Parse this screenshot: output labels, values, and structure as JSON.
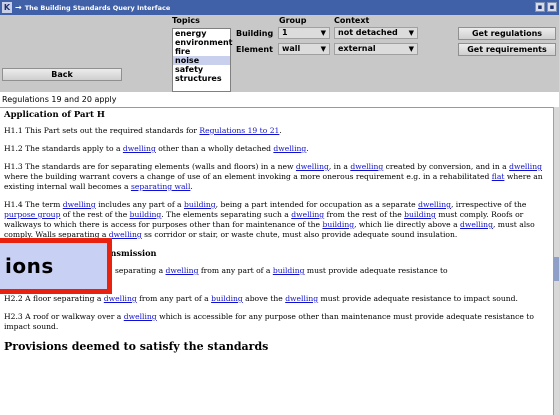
{
  "window": {
    "title": "The Building Standards Query Interface"
  },
  "headers": {
    "topics": "Topics",
    "group": "Group",
    "context": "Context"
  },
  "topics": [
    "energy",
    "environment",
    "fire",
    "noise",
    "safety",
    "structures"
  ],
  "topics_selected": "noise",
  "building": {
    "label": "Building",
    "value": "1"
  },
  "element": {
    "label": "Element",
    "value": "wall"
  },
  "context_building": "not detached",
  "context_element": "external",
  "buttons": {
    "back": "Back",
    "get_regulations": "Get regulations",
    "get_requirements": "Get requirements"
  },
  "status": "Regulations 19 and 20 apply",
  "doc": {
    "title": "Application of Part H",
    "h11_a": "H1.1 This Part sets out the required standards for ",
    "h11_link": "Regulations 19 to 21",
    "h11_b": ".",
    "h12_a": "H1.2 The standards apply to a ",
    "h12_l1": "dwelling",
    "h12_b": " other than a wholly detached ",
    "h12_l2": "dwelling",
    "h12_c": ".",
    "h13_a": "H1.3 The standards are for separating elements (walls and floors) in a new ",
    "h13_l1": "dwelling",
    "h13_b": ", in a ",
    "h13_l2": "dwelling",
    "h13_c": " created by conversion, and in a ",
    "h13_l3": "dwelling",
    "h13_d": " where the building warrant covers a change of use of an element invoking a more onerous requirement e.g. in a rehabilitated ",
    "h13_l4": "flat",
    "h13_e": " where an existing internal wall becomes a ",
    "h13_l5": "separating wall",
    "h13_f": ".",
    "h14_a": "H1.4 The term ",
    "h14_l1": "dwelling",
    "h14_b": " includes any part of a ",
    "h14_l2": "building",
    "h14_c": ", being a part intended for occupation as a separate ",
    "h14_l3": "dwelling",
    "h14_d": ", irrespective of the ",
    "h14_l4": "purpose group",
    "h14_e": " of the rest of the ",
    "h14_l5": "building",
    "h14_f": ". The elements separating such a ",
    "h14_l6": "dwelling",
    "h14_g": " from the rest of the ",
    "h14_l7": "building",
    "h14_h": " must comply. Roofs or walkways to which there is access for purposes other than for maintenance of the ",
    "h14_l8": "building",
    "h14_i": ", which lie directly above a ",
    "h14_l9": "dwelling",
    "h14_j": ", must also comply. Walls separating a ",
    "h14_l10": "dwelling",
    "h14_k": " ss corridor or stair, or waste chute, must also provide adequate sound insulation.",
    "subhead": "resist sound transmission",
    "h21_a": "separating a ",
    "h21_l1": "dwelling",
    "h21_b": " from any part of a ",
    "h21_l2": "building",
    "h21_c": " must provide adequate resistance to",
    "h22_a": " H2.2 A floor separating a ",
    "h22_l1": "dwelling",
    "h22_b": " from any part of a ",
    "h22_l2": "building",
    "h22_c": " above the ",
    "h22_l3": "dwelling",
    "h22_d": " must provide adequate resistance to impact sound.",
    "h23_a": " H2.3 A roof or walkway over a ",
    "h23_l1": "dwelling",
    "h23_b": " which is accessible for any purpose other than maintenance must provide adequate resistance to impact sound.",
    "provisions": "Provisions deemed to satisfy the standards"
  },
  "overlay_text": "ions"
}
